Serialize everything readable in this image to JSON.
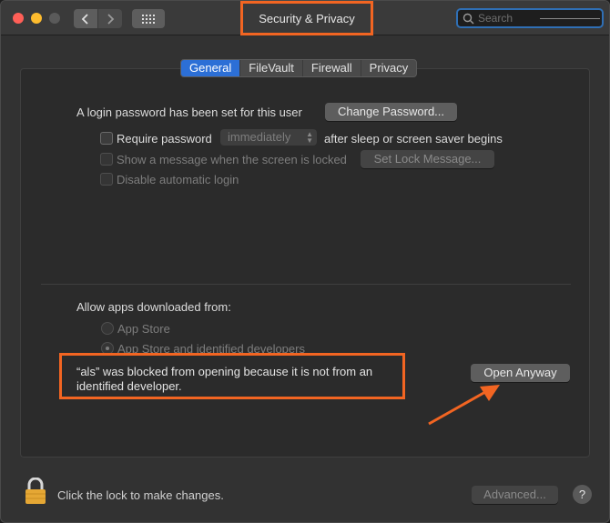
{
  "window": {
    "title": "Security & Privacy",
    "search": {
      "placeholder": "Search"
    },
    "icons": [
      "back-chevron-icon",
      "forward-chevron-icon",
      "grid-icon",
      "search-icon"
    ]
  },
  "tabs": [
    {
      "label": "General",
      "active": true
    },
    {
      "label": "FileVault",
      "active": false
    },
    {
      "label": "Firewall",
      "active": false
    },
    {
      "label": "Privacy",
      "active": false
    }
  ],
  "general": {
    "login_password_text": "A login password has been set for this user",
    "change_password_button": "Change Password...",
    "require_password": {
      "label": "Require password",
      "selected": "immediately",
      "suffix": "after sleep or screen saver begins",
      "checked": false
    },
    "show_message": {
      "label": "Show a message when the screen is locked",
      "button": "Set Lock Message...",
      "enabled": false
    },
    "disable_auto_login": {
      "label": "Disable automatic login",
      "enabled": false
    }
  },
  "downloads": {
    "heading": "Allow apps downloaded from:",
    "options": [
      {
        "label": "App Store",
        "selected": false
      },
      {
        "label": "App Store and identified developers",
        "selected": true
      }
    ],
    "blocked_message": "“als” was blocked from opening because it is not from an identified developer.",
    "open_anyway_button": "Open Anyway"
  },
  "footer": {
    "lock_text": "Click the lock to make changes.",
    "advanced_button": "Advanced...",
    "help": "?"
  },
  "annotation_color": "#f26522",
  "accent_color": "#2c6fd6"
}
